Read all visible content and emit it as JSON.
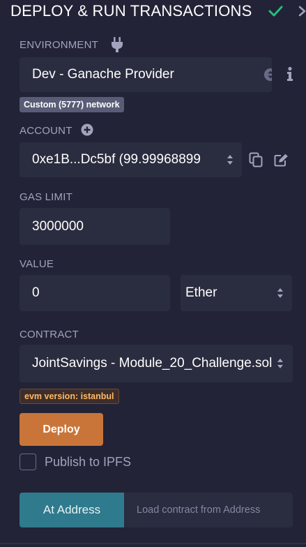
{
  "header": {
    "title": "DEPLOY & RUN TRANSACTIONS",
    "check_icon": "check-icon",
    "chevron_icon": "chevron-right-icon"
  },
  "environment": {
    "label": "ENVIRONMENT",
    "icon": "plug-icon",
    "value": "Dev - Ganache Provider",
    "badge": "Custom (5777) network",
    "info_icon": "info-icon"
  },
  "account": {
    "label": "ACCOUNT",
    "add_icon": "plus-circle-icon",
    "value": "0xe1B...Dc5bf (99.99968899",
    "copy_icon": "copy-icon",
    "edit_icon": "edit-icon"
  },
  "gas_limit": {
    "label": "GAS LIMIT",
    "value": "3000000"
  },
  "value": {
    "label": "VALUE",
    "amount": "0",
    "unit": "Ether"
  },
  "contract": {
    "label": "CONTRACT",
    "value": "JointSavings - Module_20_Challenge.sol",
    "evm_badge": "evm version: istanbul"
  },
  "actions": {
    "deploy_label": "Deploy",
    "publish_label": "Publish to IPFS",
    "publish_checked": false,
    "at_address_label": "At Address",
    "address_placeholder": "Load contract from Address"
  },
  "colors": {
    "background": "#222336",
    "field": "#2a2c3f",
    "deploy": "#c97539",
    "at_address": "#2f7a8c",
    "check": "#1fc17b",
    "label": "#a2a3bd"
  }
}
